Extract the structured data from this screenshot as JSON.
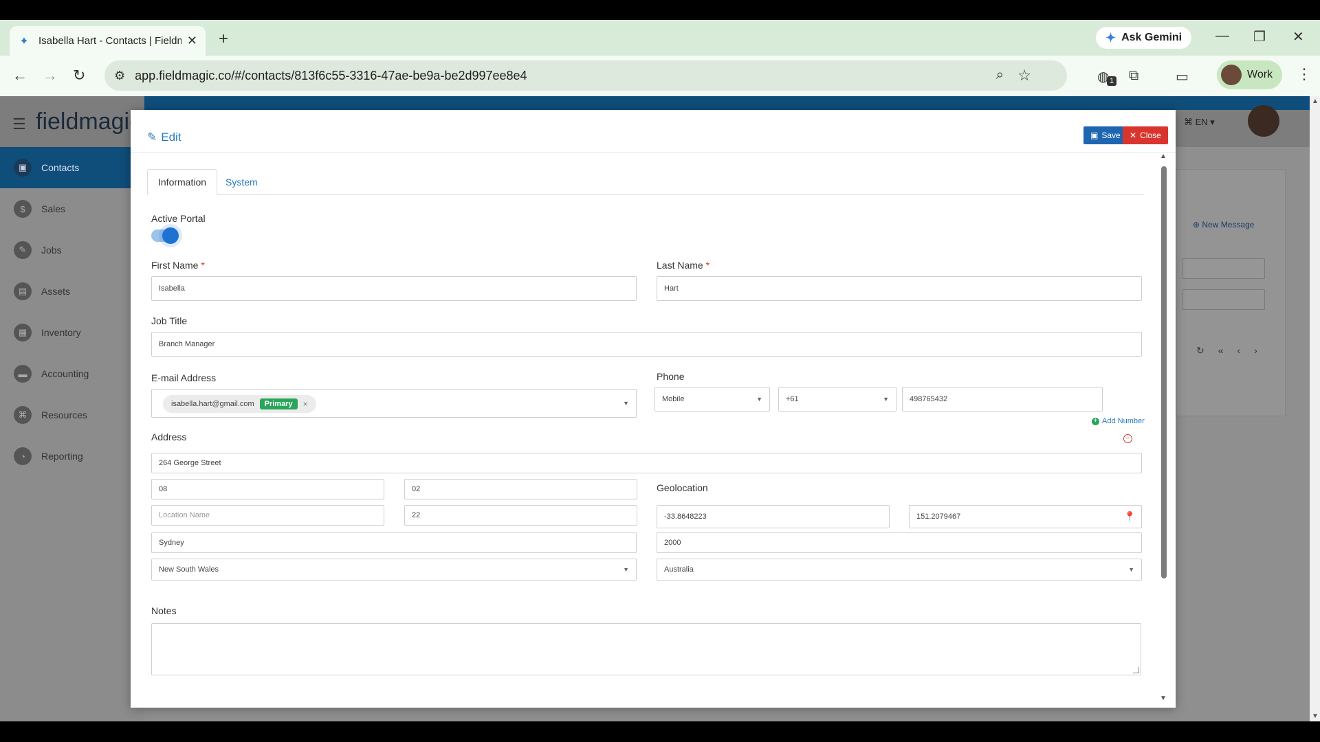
{
  "browser": {
    "tab_title": "Isabella Hart - Contacts | Fieldm",
    "new_tab": "+",
    "ask_gemini": "Ask Gemini",
    "url": "app.fieldmagic.co/#/contacts/813f6c55-3316-47ae-be9a-be2d997ee8e4",
    "profile": "Work",
    "extension_badge": "1"
  },
  "app": {
    "logo": "fieldmagic",
    "language": "EN",
    "new_message": "New Message",
    "sidebar": [
      {
        "label": "Contacts",
        "icon": "contacts-icon"
      },
      {
        "label": "Sales",
        "icon": "dollar-icon"
      },
      {
        "label": "Jobs",
        "icon": "wrench-icon"
      },
      {
        "label": "Assets",
        "icon": "briefcase-icon"
      },
      {
        "label": "Inventory",
        "icon": "inventory-icon"
      },
      {
        "label": "Accounting",
        "icon": "accounting-icon"
      },
      {
        "label": "Resources",
        "icon": "resources-icon"
      },
      {
        "label": "Reporting",
        "icon": "reporting-icon"
      }
    ]
  },
  "modal": {
    "title": "Edit",
    "save_label": "Save",
    "close_label": "Close",
    "tabs": [
      "Information",
      "System"
    ],
    "active_portal_label": "Active Portal",
    "active_portal_on": true,
    "first_name_label": "First Name",
    "first_name": "Isabella",
    "last_name_label": "Last Name",
    "last_name": "Hart",
    "job_title_label": "Job Title",
    "job_title": "Branch Manager",
    "email_label": "E-mail Address",
    "email": "isabella.hart@gmail.com",
    "email_tag": "Primary",
    "phone_label": "Phone",
    "add_number": "Add Number",
    "phone_type": "Mobile",
    "phone_code": "+61",
    "phone_number": "498765432",
    "address_label": "Address",
    "street": "264 George Street",
    "addr_field_1": "08",
    "addr_field_2": "02",
    "location_name_placeholder": "Location Name",
    "addr_field_3": "22",
    "city": "Sydney",
    "state": "New South Wales",
    "geolocation_label": "Geolocation",
    "latitude": "-33.8648223",
    "longitude": "151.2079467",
    "postcode": "2000",
    "country": "Australia",
    "notes_label": "Notes",
    "notes": ""
  }
}
